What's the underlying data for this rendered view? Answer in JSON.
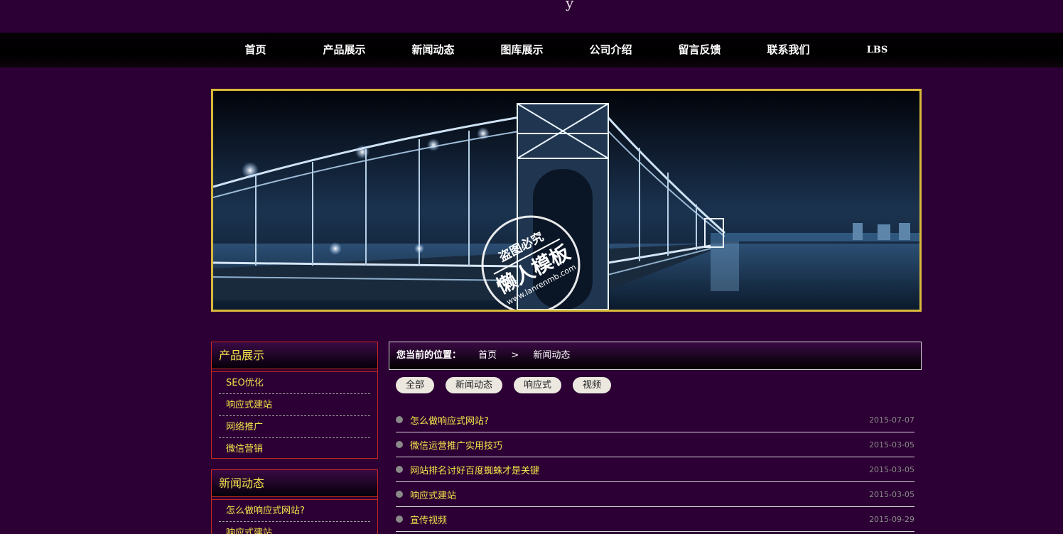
{
  "logo_fragment": "y",
  "nav": {
    "items": [
      "首页",
      "产品展示",
      "新闻动态",
      "图库展示",
      "公司介绍",
      "留言反馈",
      "联系我们",
      "LBS"
    ]
  },
  "banner": {
    "watermark_line1": "盗图必究",
    "watermark_line2": "懒人模板",
    "watermark_url": "www.lanrenmb.com"
  },
  "sidebar": {
    "products": {
      "title": "产品展示",
      "items": [
        "SEO优化",
        "响应式建站",
        "网络推广",
        "微信营销"
      ]
    },
    "news": {
      "title": "新闻动态",
      "items": [
        "怎么做响应式网站?",
        "响应式建站"
      ]
    }
  },
  "breadcrumb": {
    "label": "您当前的位置：",
    "home": "首页",
    "separator": ">",
    "current": "新闻动态"
  },
  "filters": [
    "全部",
    "新闻动态",
    "响应式",
    "视频"
  ],
  "news_list": [
    {
      "title": "怎么做响应式网站?",
      "date": "2015-07-07"
    },
    {
      "title": "微信运营推广实用技巧",
      "date": "2015-03-05"
    },
    {
      "title": "网站排名讨好百度蜘蛛才是关键",
      "date": "2015-03-05"
    },
    {
      "title": "响应式建站",
      "date": "2015-03-05"
    },
    {
      "title": "宣传视频",
      "date": "2015-09-29"
    }
  ],
  "colors": {
    "background": "#2c0034",
    "accent_yellow": "#f4e24a",
    "side_border": "#c8281c",
    "banner_frame": "#d9b83a"
  }
}
